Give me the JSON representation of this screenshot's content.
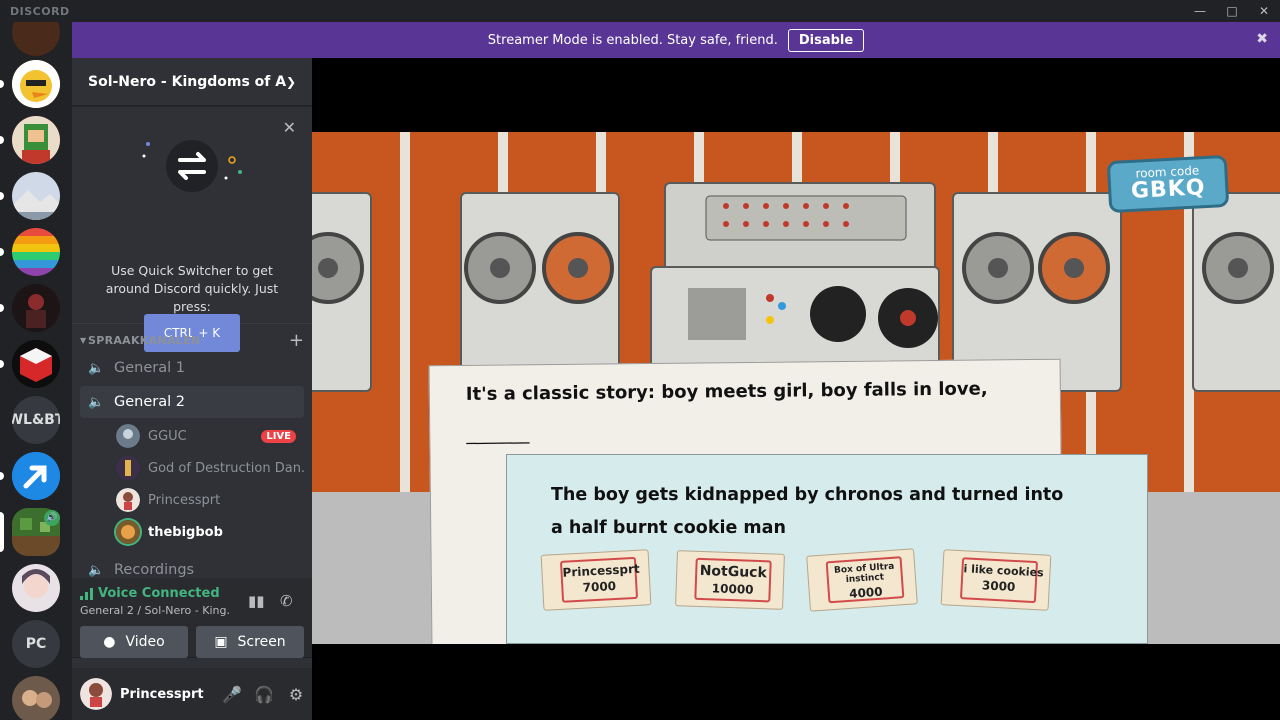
{
  "app": {
    "brand": "DISCORD"
  },
  "streamer_bar": {
    "message": "Streamer Mode is enabled. Stay safe, friend.",
    "disable_label": "Disable"
  },
  "server": {
    "name": "Sol-Nero - Kingdoms of A..."
  },
  "quick_switcher": {
    "text": "Use Quick Switcher to get around Discord quickly. Just press:",
    "shortcut": "CTRL + K"
  },
  "rail": {
    "text_servers": [
      "WL&BT",
      "PC"
    ]
  },
  "category": {
    "name": "SPRAAKKANALEN"
  },
  "channels": [
    {
      "name": "General 1"
    },
    {
      "name": "General 2"
    },
    {
      "name": "Recordings"
    }
  ],
  "voice_users": [
    {
      "name": "GGUC",
      "badge": "LIVE"
    },
    {
      "name": "God of Destruction Dan..."
    },
    {
      "name": "Princessprt"
    },
    {
      "name": "thebigbob"
    }
  ],
  "voice_panel": {
    "status": "Voice Connected",
    "channel": "General 2 / Sol-Nero - King...",
    "video_label": "Video",
    "screen_label": "Screen"
  },
  "user": {
    "name": "Princessprt"
  },
  "game": {
    "room_label": "room code",
    "room_code": "GBKQ",
    "prompt": "It's a classic story: boy meets girl, boy falls in love,",
    "blank": "_______",
    "answer": "The boy gets kidnapped by chronos and turned into a half burnt cookie man",
    "tickets": [
      {
        "name": "Princessprt",
        "score": "7000"
      },
      {
        "name": "NotGuck",
        "score": "10000"
      },
      {
        "name": "Box of Ultra instinct",
        "score": "4000"
      },
      {
        "name": "i like cookies",
        "score": "3000"
      }
    ]
  },
  "colors": {
    "accent": "#7289da",
    "streamer": "#593695",
    "live": "#ed4245",
    "connected": "#43b581"
  }
}
